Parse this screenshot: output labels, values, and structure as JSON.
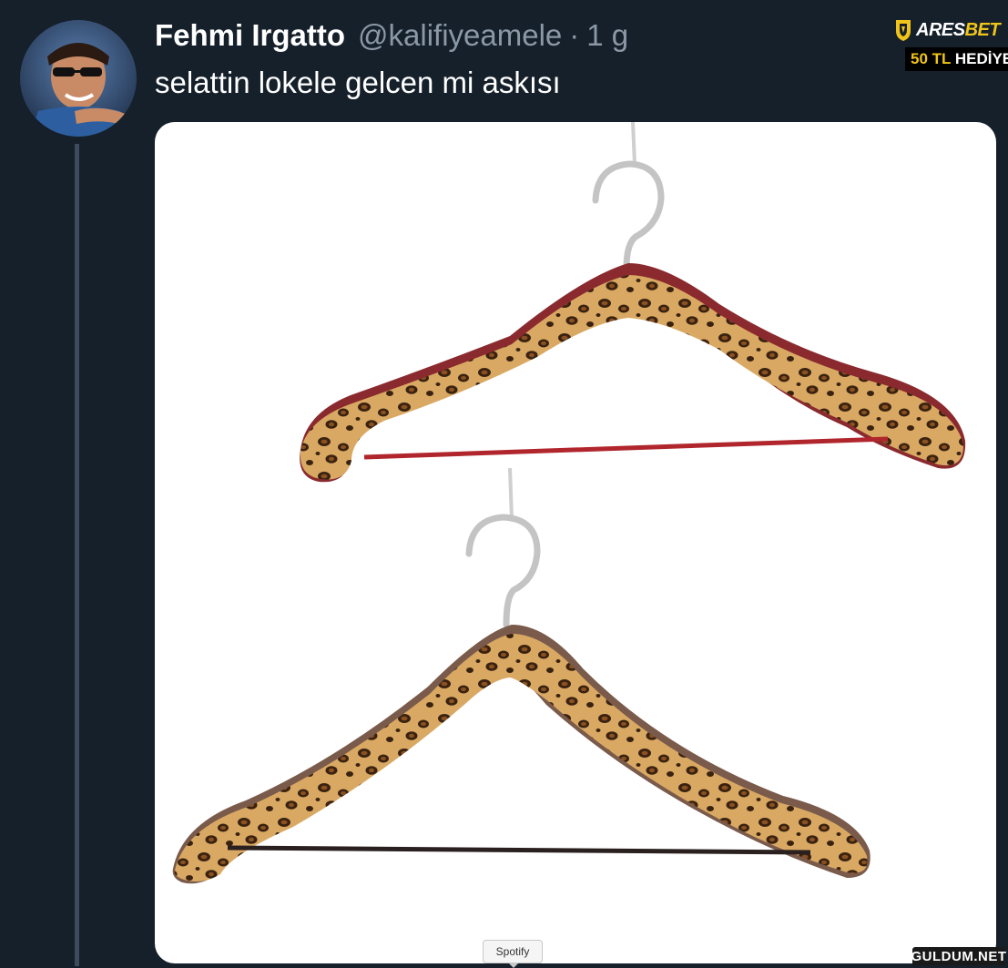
{
  "tweet": {
    "author_name": "Fehmi Irgatto",
    "handle": "@kalifiyeamele",
    "separator": "·",
    "time": "1 g",
    "text": "selattin lokele gelcen mi askısı"
  },
  "ad": {
    "brand_left": "ARES",
    "brand_right": "BET",
    "gift_amount": "50 TL",
    "gift_label": "HEDİYE",
    "accent_color": "#f0c419"
  },
  "media": {
    "tooltip": "Spotify",
    "subject": "two leopard-print clothes hangers",
    "icon": "hanger-image"
  },
  "watermark": {
    "text": "GULDUM.NET"
  },
  "colors": {
    "background": "#15202b",
    "secondary_text": "#8b98a5",
    "thread_line": "#3d4c5c"
  }
}
